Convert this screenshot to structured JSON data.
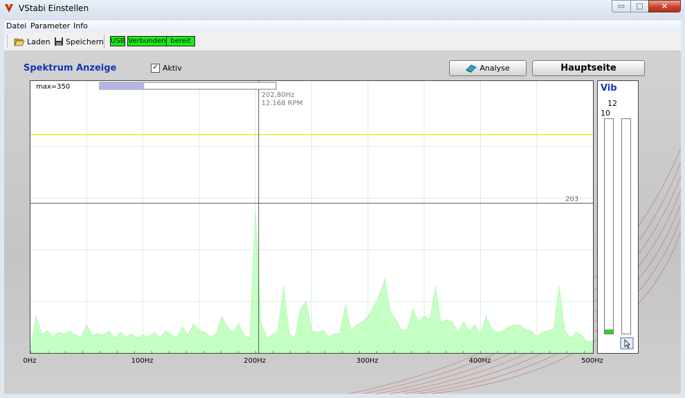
{
  "window": {
    "title": "VStabi Einstellen",
    "buttons": {
      "minimize": "▭",
      "maximize": "□",
      "close": "✕"
    }
  },
  "menu": [
    "Datei",
    "Parameter",
    "Info"
  ],
  "toolbar": {
    "load_label": "Laden",
    "save_label": "Speichern",
    "status": [
      "USB",
      "Verbunden",
      "bereit"
    ]
  },
  "spectrum": {
    "title": "Spektrum Anzeige",
    "aktiv_label": "Aktiv",
    "aktiv_checked": true,
    "max_label": "max=350",
    "max_level": 0.25,
    "cursor_freq": "202,80Hz",
    "cursor_rpm": "12.168 RPM",
    "line_label": "203"
  },
  "buttons": {
    "analyse": "Analyse",
    "hauptseite": "Hauptseite"
  },
  "vib": {
    "title": "Vib",
    "value_a": "12",
    "value_b": "10",
    "level_a": 0.02,
    "level_b": 0.0
  },
  "icons": {
    "load": "folder-open-icon",
    "save": "floppy-disk-icon",
    "analyse": "book-icon",
    "vib": "cursor-icon"
  },
  "colors": {
    "accent": "#1a34b8",
    "status_green": "#1ee81e",
    "spectrum_fill": "#c4ffc4",
    "yellow_line": "#e8e800"
  },
  "chart_data": {
    "type": "area",
    "title": "",
    "xlabel": "",
    "ylabel": "",
    "xlim": [
      0,
      500
    ],
    "ylim": [
      0,
      350
    ],
    "x_ticks": [
      "0Hz",
      "100Hz",
      "200Hz",
      "300Hz",
      "400Hz",
      "500Hz"
    ],
    "grid": true,
    "cursor_x": 202.8,
    "reference_line_y": 203,
    "yellow_line_y": 296,
    "x": [
      0,
      5,
      10,
      15,
      20,
      25,
      30,
      35,
      40,
      45,
      50,
      55,
      60,
      65,
      70,
      75,
      80,
      85,
      90,
      95,
      100,
      105,
      110,
      115,
      120,
      125,
      130,
      135,
      140,
      145,
      150,
      155,
      160,
      165,
      170,
      175,
      180,
      185,
      190,
      195,
      200,
      205,
      210,
      215,
      220,
      225,
      230,
      235,
      240,
      245,
      250,
      255,
      260,
      265,
      270,
      275,
      280,
      285,
      290,
      295,
      300,
      305,
      310,
      315,
      320,
      325,
      330,
      335,
      340,
      345,
      350,
      355,
      360,
      365,
      370,
      375,
      380,
      385,
      390,
      395,
      400,
      405,
      410,
      415,
      420,
      425,
      430,
      435,
      440,
      445,
      450,
      455,
      460,
      465,
      470,
      475,
      480,
      485,
      490,
      495,
      500
    ],
    "y": [
      5,
      50,
      25,
      30,
      22,
      28,
      25,
      30,
      24,
      22,
      38,
      24,
      26,
      24,
      30,
      20,
      28,
      22,
      26,
      20,
      24,
      22,
      28,
      20,
      30,
      25,
      20,
      36,
      24,
      40,
      30,
      28,
      22,
      26,
      50,
      35,
      28,
      40,
      24,
      20,
      192,
      40,
      20,
      25,
      30,
      90,
      26,
      20,
      60,
      70,
      30,
      28,
      30,
      22,
      26,
      26,
      65,
      30,
      38,
      42,
      50,
      62,
      78,
      100,
      55,
      45,
      30,
      32,
      60,
      42,
      50,
      45,
      90,
      40,
      45,
      42,
      28,
      42,
      30,
      38,
      25,
      50,
      32,
      28,
      30,
      35,
      38,
      38,
      32,
      30,
      22,
      28,
      30,
      32,
      90,
      30,
      20,
      28,
      24,
      15,
      16
    ]
  }
}
